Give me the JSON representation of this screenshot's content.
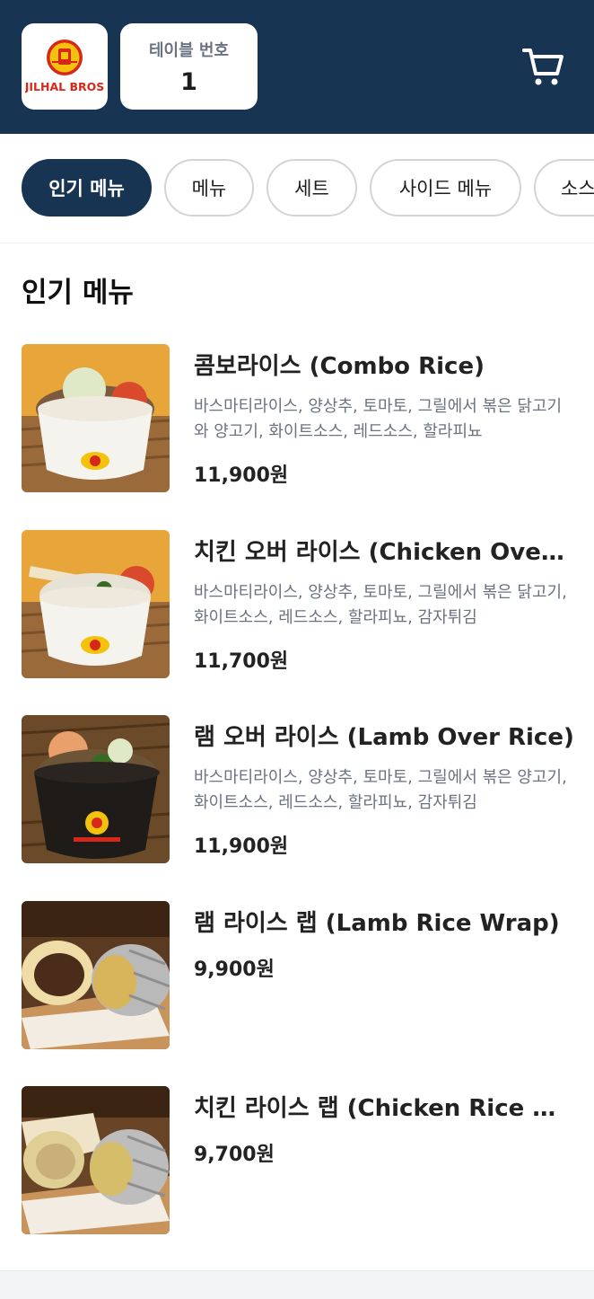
{
  "header": {
    "logo_text": "JILHAL BROS",
    "table_label": "테이블 번호",
    "table_number": "1",
    "cart_icon": "cart-icon",
    "background": "#173553"
  },
  "tabs": [
    {
      "label": "인기 메뉴",
      "active": true
    },
    {
      "label": "메뉴",
      "active": false
    },
    {
      "label": "세트",
      "active": false
    },
    {
      "label": "사이드 메뉴",
      "active": false
    },
    {
      "label": "소스",
      "active": false
    }
  ],
  "section": {
    "title": "인기 메뉴"
  },
  "items": [
    {
      "name": "콤보라이스 (Combo Rice)",
      "description": "바스마티라이스, 양상추, 토마토, 그릴에서 볶은 닭고기와 양고기, 화이트소스, 레드소스, 할라피뇨",
      "price": "11,900원"
    },
    {
      "name": "치킨 오버 라이스 (Chicken Over Rice)",
      "description": "바스마티라이스, 양상추, 토마토, 그릴에서 볶은 닭고기, 화이트소스, 레드소스, 할라피뇨, 감자튀김",
      "price": "11,700원"
    },
    {
      "name": "램 오버 라이스 (Lamb Over Rice)",
      "description": "바스마티라이스, 양상추, 토마토, 그릴에서 볶은 양고기, 화이트소스, 레드소스, 할라피뇨, 감자튀김",
      "price": "11,900원"
    },
    {
      "name": "램 라이스 랩 (Lamb Rice Wrap)",
      "price": "9,900원"
    },
    {
      "name": "치킨 라이스 랩 (Chicken Rice Wrap)",
      "price": "9,700원"
    }
  ],
  "colors": {
    "brand": "#173553",
    "logo_red": "#d62718",
    "logo_yellow": "#f4c20d"
  }
}
